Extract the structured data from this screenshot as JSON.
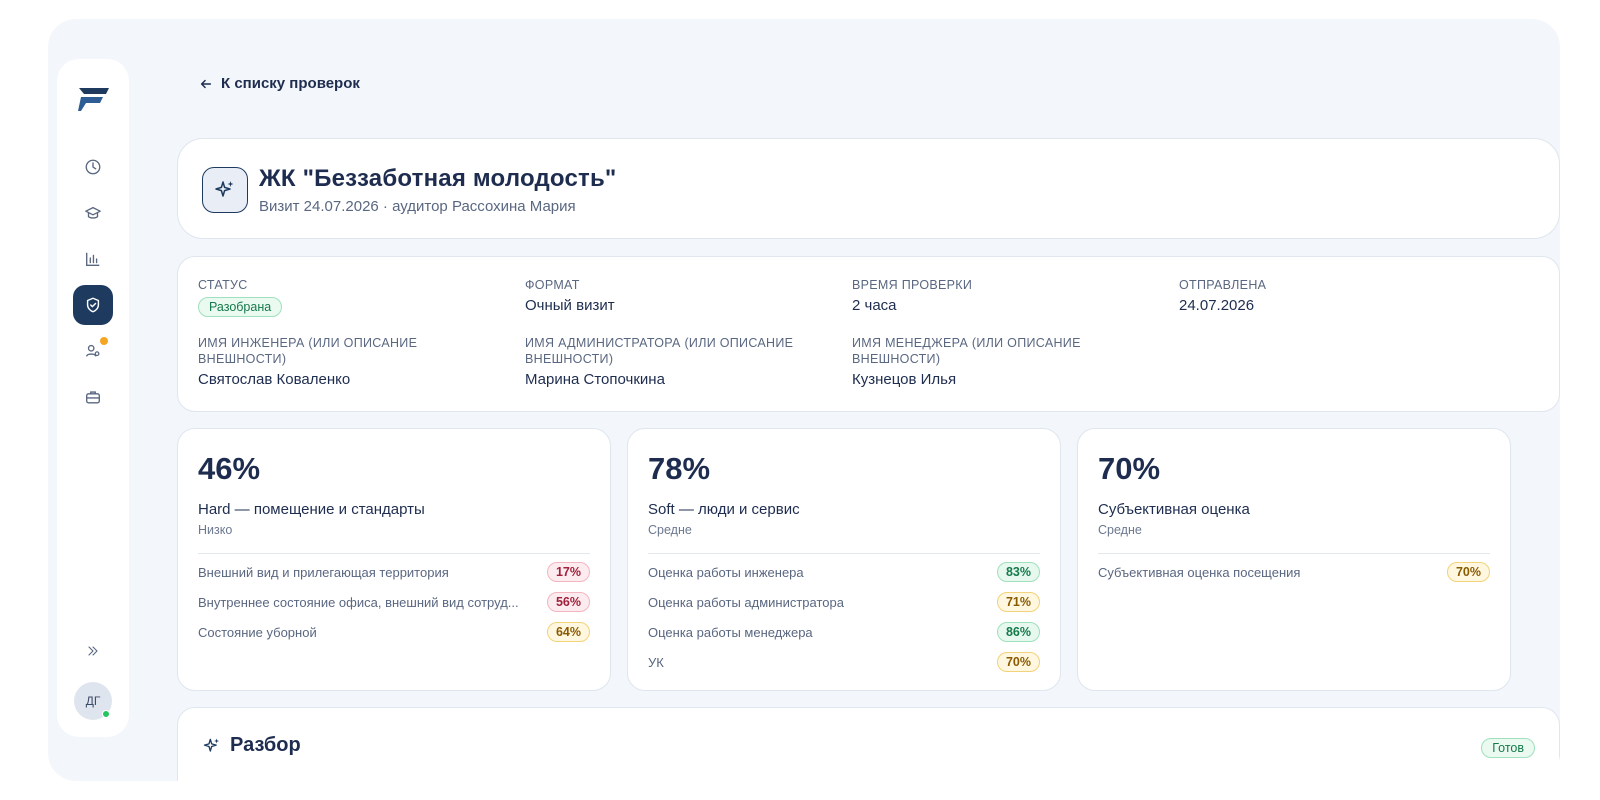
{
  "app": {
    "accent": "#1e3a5f",
    "nav_icons": [
      "clock-icon",
      "graduation-cap-icon",
      "bar-chart-icon",
      "shield-check-icon",
      "users-icon",
      "briefcase-icon"
    ],
    "expand_label": "»",
    "user_initials": "ДГ"
  },
  "nav": {
    "back_label": "К списку проверок"
  },
  "header": {
    "title": "ЖК \"Беззаботная молодость\"",
    "subtitle": "Визит 24.07.2026 · аудитор Рассохина Мария"
  },
  "info": {
    "status": {
      "label": "СТАТУС",
      "value": "Разобрана"
    },
    "format": {
      "label": "ФОРМАТ",
      "value": "Очный визит"
    },
    "duration": {
      "label": "ВРЕМЯ ПРОВЕРКИ",
      "value": "2 часа"
    },
    "sent": {
      "label": "ОТПРАВЛЕНА",
      "value": "24.07.2026"
    },
    "engineer": {
      "label": "ИМЯ ИНЖЕНЕРА (ИЛИ ОПИСАНИЕ ВНЕШНОСТИ)",
      "value": "Святослав Коваленко"
    },
    "admin": {
      "label": "ИМЯ АДМИНИСТРАТОРА (ИЛИ ОПИСАНИЕ ВНЕШНОСТИ)",
      "value": "Марина Стопочкина"
    },
    "manager": {
      "label": "ИМЯ МЕНЕДЖЕРА (ИЛИ ОПИСАНИЕ ВНЕШНОСТИ)",
      "value": "Кузнецов Илья"
    }
  },
  "scores": [
    {
      "percent": "46%",
      "name": "Hard — помещение и стандарты",
      "level": "Низко",
      "items": [
        {
          "label": "Внешний вид и прилегающая территория",
          "value": "17%",
          "tone": "red"
        },
        {
          "label": "Внутреннее состояние офиса, внешний вид сотруд...",
          "value": "56%",
          "tone": "red"
        },
        {
          "label": "Состояние уборной",
          "value": "64%",
          "tone": "yellow"
        }
      ]
    },
    {
      "percent": "78%",
      "name": "Soft — люди и сервис",
      "level": "Средне",
      "items": [
        {
          "label": "Оценка работы инженера",
          "value": "83%",
          "tone": "green"
        },
        {
          "label": "Оценка работы администратора",
          "value": "71%",
          "tone": "yellow"
        },
        {
          "label": "Оценка работы менеджера",
          "value": "86%",
          "tone": "green"
        },
        {
          "label": "УК",
          "value": "70%",
          "tone": "yellow"
        }
      ]
    },
    {
      "percent": "70%",
      "name": "Субъективная оценка",
      "level": "Средне",
      "items": [
        {
          "label": "Субъективная оценка посещения",
          "value": "70%",
          "tone": "yellow"
        }
      ]
    }
  ],
  "analysis": {
    "title": "Разбор",
    "status": "Готов"
  }
}
